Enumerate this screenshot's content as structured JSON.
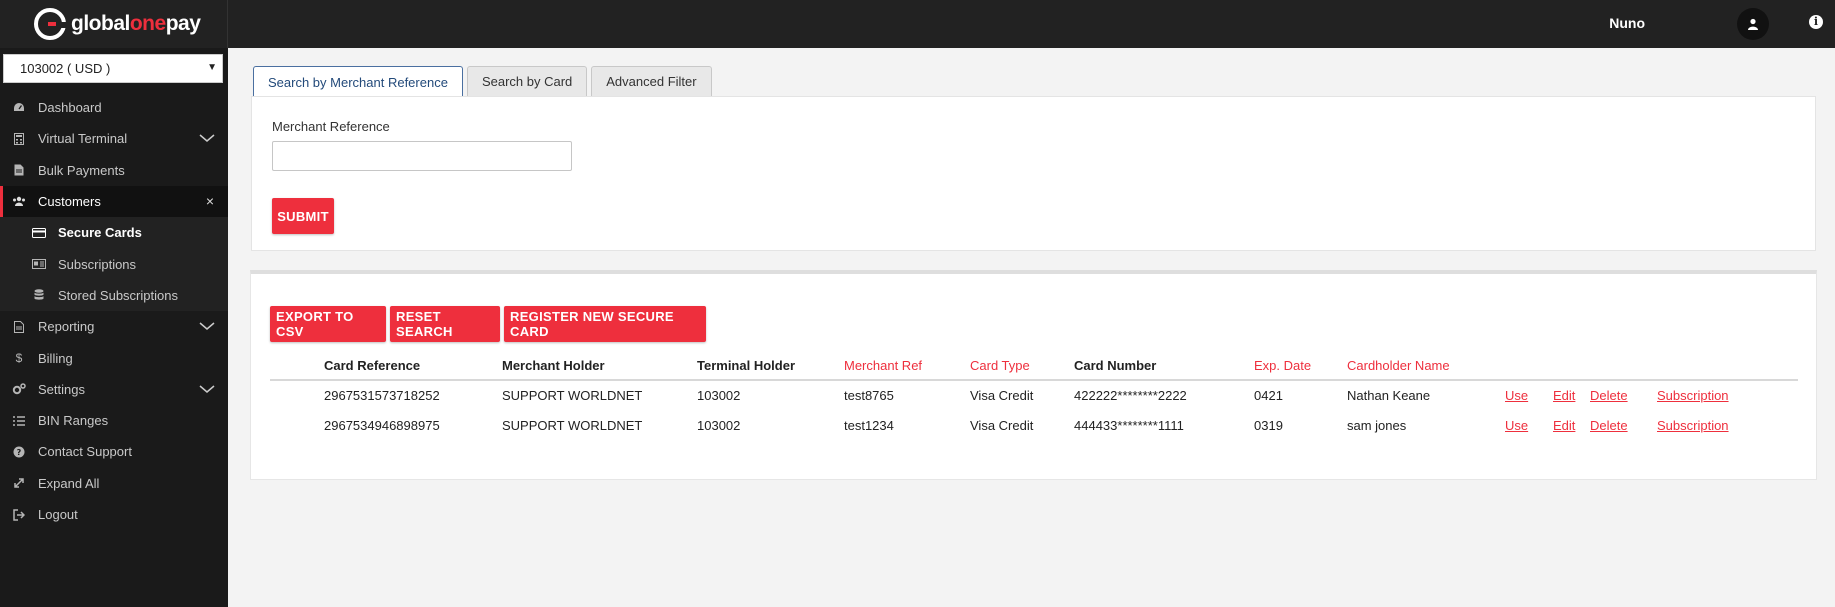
{
  "brand": {
    "name_part1": "global",
    "name_part2": "one",
    "name_part3": "pay"
  },
  "header": {
    "user_name": "Nuno",
    "info_icon": "i"
  },
  "sidebar": {
    "account_selector": "103002 ( USD )",
    "items": [
      {
        "label": "Dashboard",
        "icon": "dashboard-icon"
      },
      {
        "label": "Virtual Terminal",
        "icon": "calculator-icon"
      },
      {
        "label": "Bulk Payments",
        "icon": "file-icon"
      },
      {
        "label": "Customers",
        "icon": "users-icon",
        "close": "×"
      },
      {
        "label": "Secure Cards",
        "icon": "credit-card-icon"
      },
      {
        "label": "Subscriptions",
        "icon": "id-card-icon"
      },
      {
        "label": "Stored Subscriptions",
        "icon": "database-icon"
      },
      {
        "label": "Reporting",
        "icon": "report-icon"
      },
      {
        "label": "Billing",
        "icon": "dollar-icon"
      },
      {
        "label": "Settings",
        "icon": "cogs-icon"
      },
      {
        "label": "BIN Ranges",
        "icon": "list-icon"
      },
      {
        "label": "Contact Support",
        "icon": "question-icon"
      },
      {
        "label": "Expand All",
        "icon": "expand-icon"
      },
      {
        "label": "Logout",
        "icon": "logout-icon"
      }
    ]
  },
  "tabs": [
    {
      "label": "Search by Merchant Reference"
    },
    {
      "label": "Search by Card"
    },
    {
      "label": "Advanced Filter"
    }
  ],
  "search": {
    "label": "Merchant Reference",
    "value": "",
    "submit": "SUBMIT"
  },
  "actions": {
    "export": "EXPORT TO CSV",
    "reset": "RESET SEARCH",
    "register": "REGISTER NEW SECURE CARD"
  },
  "table": {
    "headers": [
      "Card Reference",
      "Merchant Holder",
      "Terminal Holder",
      "Merchant Ref",
      "Card Type",
      "Card Number",
      "Exp. Date",
      "Cardholder Name"
    ],
    "rows": [
      {
        "card_reference": "2967531573718252",
        "merchant_holder": "SUPPORT WORLDNET",
        "terminal_holder": "103002",
        "merchant_ref": "test8765",
        "card_type": "Visa Credit",
        "card_number": "422222********2222",
        "exp_date": "0421",
        "cardholder": "Nathan Keane"
      },
      {
        "card_reference": "2967534946898975",
        "merchant_holder": "SUPPORT WORLDNET",
        "terminal_holder": "103002",
        "merchant_ref": "test1234",
        "card_type": "Visa Credit",
        "card_number": "444433********1111",
        "exp_date": "0319",
        "cardholder": "sam jones"
      }
    ],
    "row_actions": {
      "use": "Use",
      "edit": "Edit",
      "delete": "Delete",
      "subscription": "Subscription"
    }
  },
  "colors": {
    "accent": "#ee2f3d",
    "topbar": "#222222",
    "sidebar": "#1a1a1a"
  }
}
